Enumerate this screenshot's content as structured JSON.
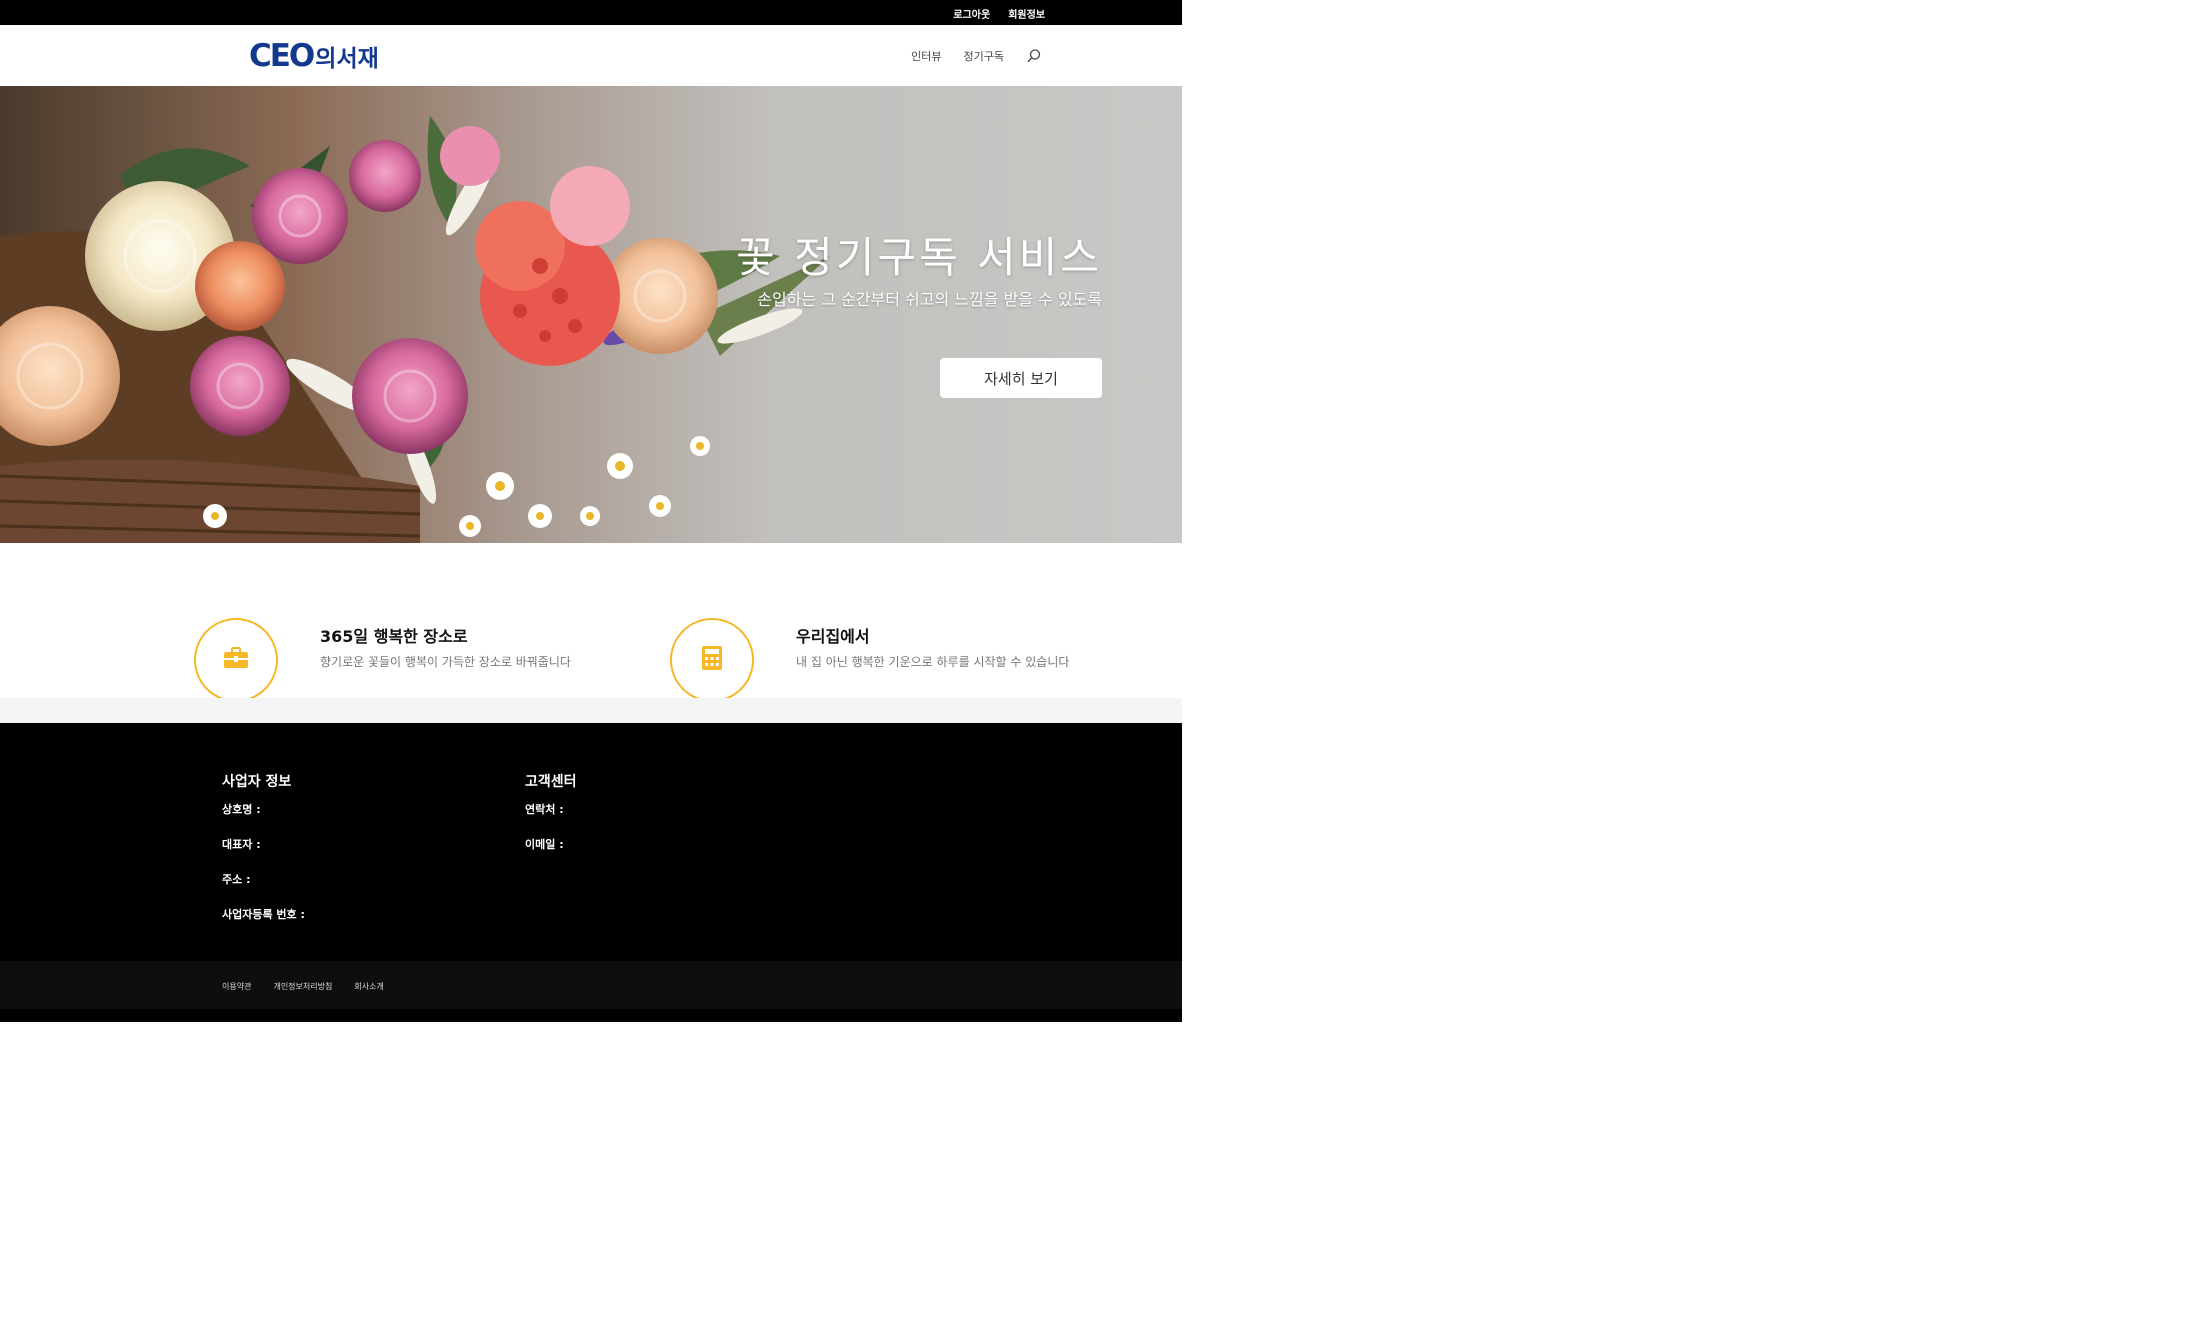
{
  "topbar": {
    "links": [
      "로그아웃",
      "회원정보"
    ]
  },
  "header": {
    "logo": {
      "mark": "CEO",
      "text": "의서재"
    },
    "nav": [
      "인터뷰",
      "정기구독"
    ],
    "search_icon": "search-icon"
  },
  "hero": {
    "title": "꽃 정기구독 서비스",
    "subtitle": "손입하는 그 순간부터 쉬고의 느낌을 받을 수 있도록",
    "button": "자세히 보기"
  },
  "features": [
    {
      "icon": "briefcase-icon",
      "title": "365일 행복한 장소로",
      "desc": "향기로운 꽃들이 행복이 가득한 장소로 바꿔줍니다"
    },
    {
      "icon": "calculator-icon",
      "title": "우리집에서",
      "desc": "내 집 아닌 행복한 기운으로 하루를 시작할 수 있습니다"
    }
  ],
  "footer": {
    "business": {
      "title": "사업자 정보",
      "rows": [
        "상호명 :",
        "대표자 :",
        "주소 :",
        "사업자등록 번호 :"
      ]
    },
    "support": {
      "title": "고객센터",
      "rows": [
        "연락처 :",
        "이메일 :"
      ]
    },
    "links": [
      "이용약관",
      "개인정보처리방침",
      "회사소개"
    ]
  },
  "colors": {
    "accent": "#f5b829",
    "brand": "#13398f",
    "footer_bg": "#000000"
  }
}
